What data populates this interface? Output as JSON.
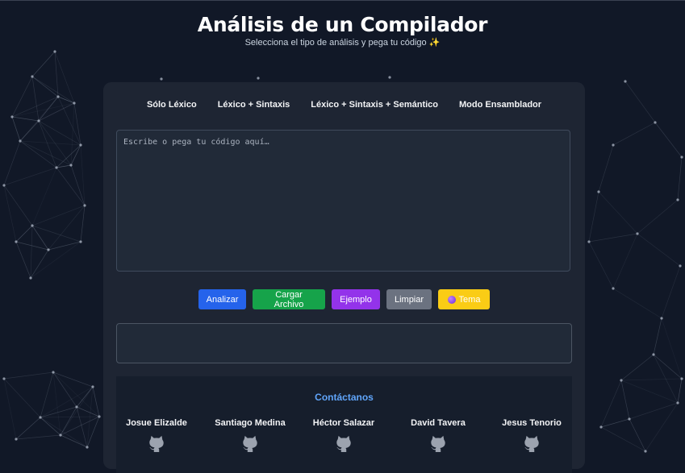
{
  "header": {
    "title": "Análisis de un Compilador",
    "subtitle": "Selecciona el tipo de análisis y pega tu código ✨"
  },
  "tabs": [
    {
      "label": "Sólo Léxico"
    },
    {
      "label": "Léxico + Sintaxis"
    },
    {
      "label": "Léxico + Sintaxis + Semántico"
    },
    {
      "label": "Modo Ensamblador"
    }
  ],
  "editor": {
    "placeholder": "Escribe o pega tu código aquí…",
    "value": ""
  },
  "buttons": {
    "analizar": "Analizar",
    "cargar": "Cargar Archivo",
    "ejemplo": "Ejemplo",
    "limpiar": "Limpiar",
    "tema": "Tema"
  },
  "output": {
    "text": ""
  },
  "contact": {
    "title": "Contáctanos",
    "members": [
      {
        "name": "Josue Elizalde",
        "icon": "github-icon"
      },
      {
        "name": "Santiago Medina",
        "icon": "github-icon"
      },
      {
        "name": "Héctor Salazar",
        "icon": "github-icon"
      },
      {
        "name": "David Tavera",
        "icon": "github-icon"
      },
      {
        "name": "Jesus Tenorio",
        "icon": "github-icon"
      }
    ]
  },
  "colors": {
    "background": "#111827",
    "card": "#1e2533",
    "analizar": "#2563eb",
    "cargar": "#16a34a",
    "ejemplo": "#9333ea",
    "limpiar": "#6b7280",
    "tema": "#facc15",
    "contact_title": "#60a5fa"
  }
}
